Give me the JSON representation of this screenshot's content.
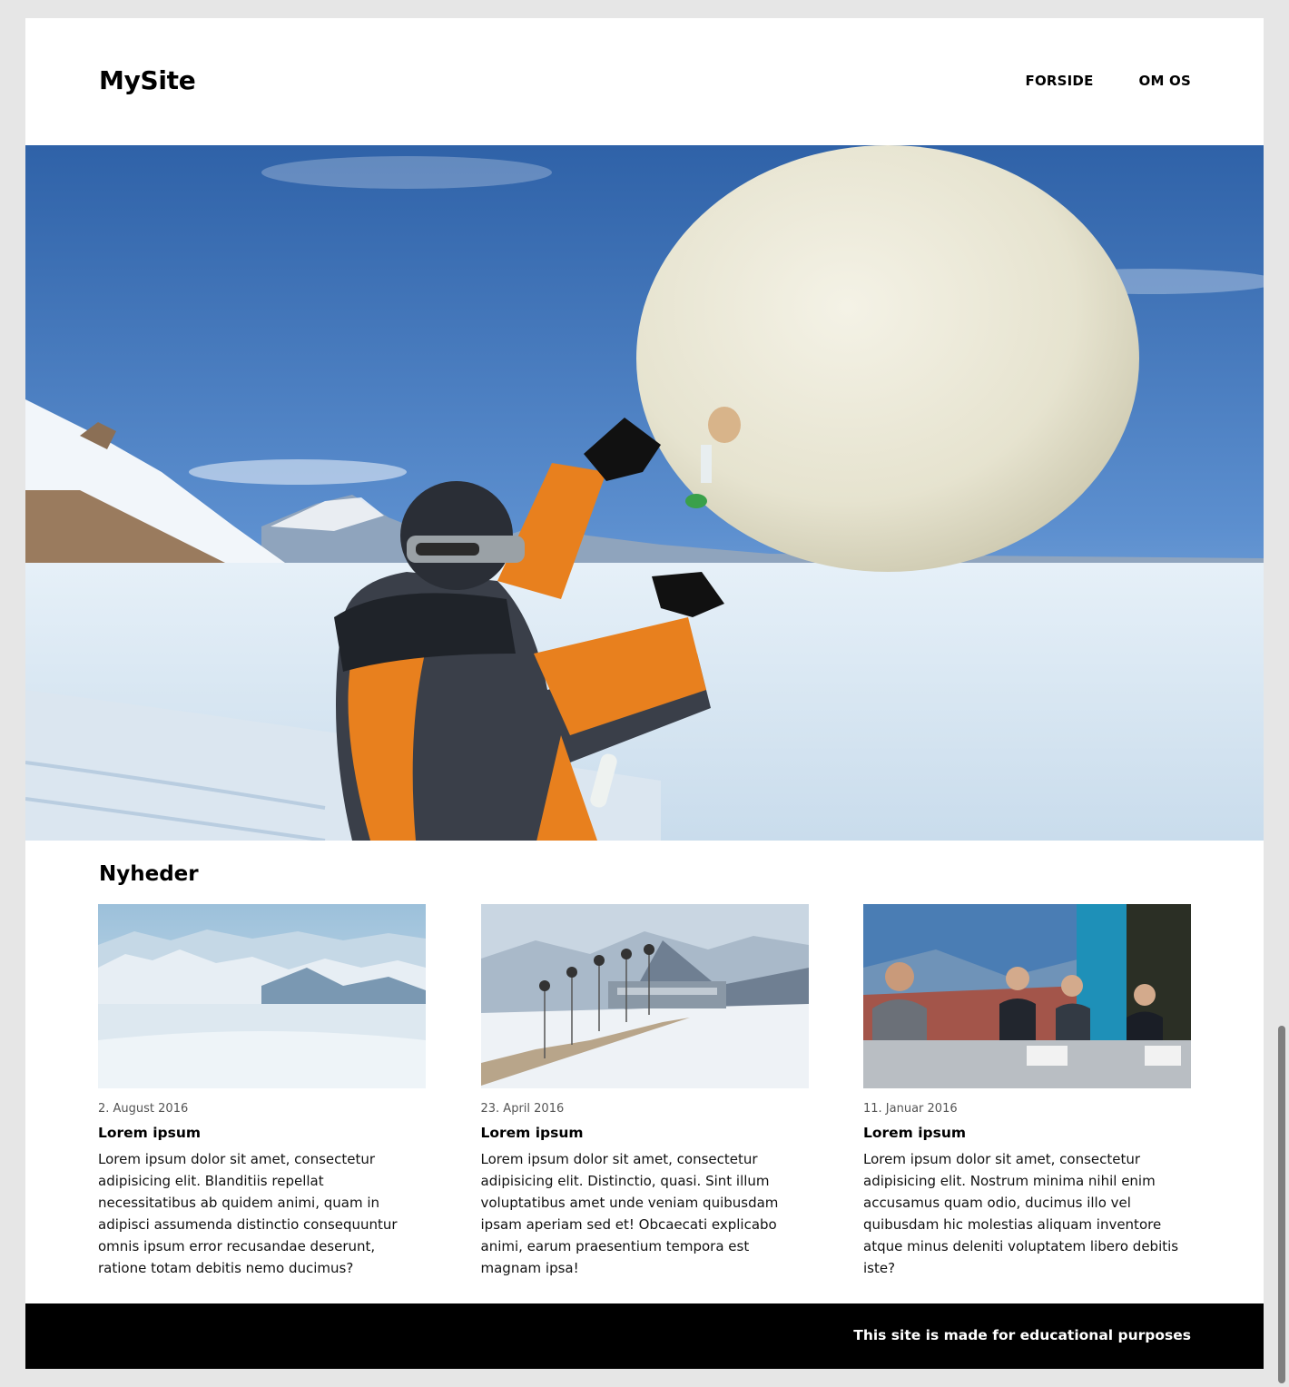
{
  "site": {
    "logo": "MySite"
  },
  "nav": {
    "items": [
      {
        "label": "FORSIDE"
      },
      {
        "label": "OM OS"
      }
    ]
  },
  "hero": {
    "image": "weather-balloon-antarctica-photo"
  },
  "news": {
    "heading": "Nyheder",
    "articles": [
      {
        "image": "snowy-mountain-landscape-photo",
        "date": "2. August 2016",
        "title": "Lorem ipsum",
        "text": "Lorem ipsum dolor sit amet, consectetur adipisicing elit. Blanditiis repellat necessitatibus ab quidem animi, quam in adipisci assumenda distinctio consequuntur omnis ipsum error recusandae deserunt, ratione totam debitis nemo ducimus?"
      },
      {
        "image": "research-station-wind-turbines-photo",
        "date": "23. April 2016",
        "title": "Lorem ipsum",
        "text": "Lorem ipsum dolor sit amet, consectetur adipisicing elit. Distinctio, quasi. Sint illum voluptatibus amet unde veniam quibusdam ipsam aperiam sed et! Obcaecati explicabo animi, earum praesentium tempora est magnam ipsa!"
      },
      {
        "image": "conference-panel-photo",
        "date": "11. Januar 2016",
        "title": "Lorem ipsum",
        "text": "Lorem ipsum dolor sit amet, consectetur adipisicing elit. Nostrum minima nihil enim accusamus quam odio, ducimus illo vel quibusdam hic molestias aliquam inventore atque minus deleniti voluptatem libero debitis iste?"
      }
    ]
  },
  "footer": {
    "text": "This site is made for educational purposes"
  },
  "colors": {
    "footer_bg": "#000000",
    "page_bg": "#e6e6e6",
    "sky": "#3f75b8",
    "jacket": "#e8801e"
  }
}
